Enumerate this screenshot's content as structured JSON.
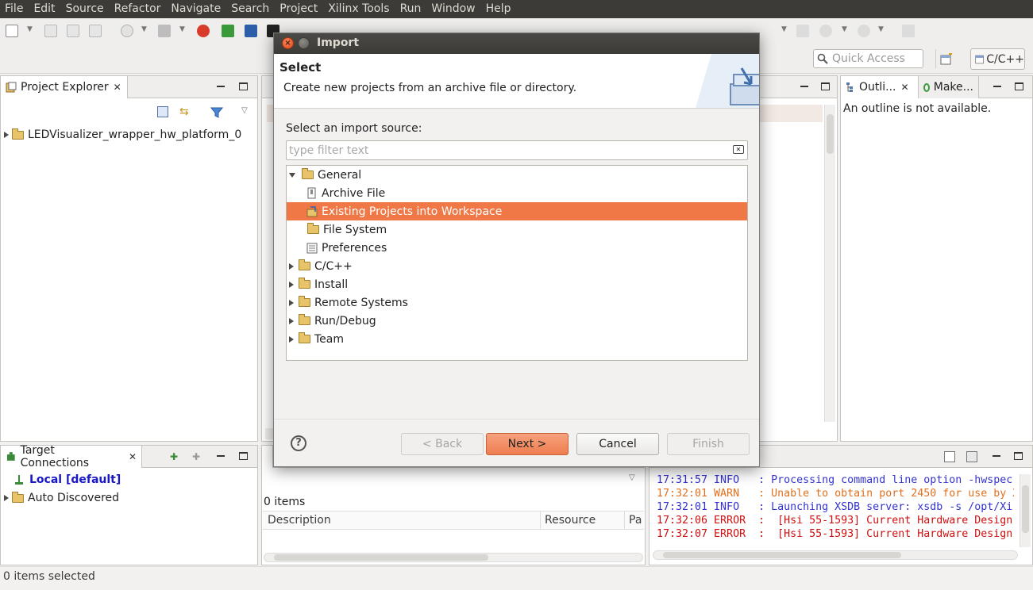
{
  "menubar": {
    "items": [
      "File",
      "Edit",
      "Source",
      "Refactor",
      "Navigate",
      "Search",
      "Project",
      "Xilinx Tools",
      "Run",
      "Window",
      "Help"
    ]
  },
  "toolbar": {
    "quick_access_placeholder": "Quick Access",
    "perspective_label": "C/C++"
  },
  "project_explorer": {
    "tab_label": "Project Explorer",
    "items": [
      {
        "label": "LEDVisualizer_wrapper_hw_platform_0"
      }
    ]
  },
  "outline": {
    "tab_label": "Outli...",
    "tab2_label": "Make...",
    "message": "An outline is not available."
  },
  "target_connections": {
    "tab_label": "Target Connections",
    "items": [
      "Local [default]",
      "Auto Discovered"
    ]
  },
  "problems": {
    "count_label": "0 items",
    "columns": [
      "Description",
      "Resource",
      "Pa"
    ]
  },
  "console": {
    "lines": [
      {
        "time": "17:31:57",
        "level": "INFO",
        "text": "17:31:57 INFO   : Processing command line option -hwspec",
        "color": "#3333cc"
      },
      {
        "time": "17:32:01",
        "level": "WARN",
        "text": "17:32:01 WARN   : Unable to obtain port 2450 for use by X",
        "color": "#e0701e"
      },
      {
        "time": "17:32:01",
        "level": "INFO",
        "text": "17:32:01 INFO   : Launching XSDB server: xsdb -s /opt/Xi",
        "color": "#3333cc"
      },
      {
        "time": "17:32:06",
        "level": "ERROR",
        "text": "17:32:06 ERROR  :  [Hsi 55-1593] Current Hardware Design",
        "color": "#cc1111"
      },
      {
        "time": "17:32:07",
        "level": "ERROR",
        "text": "17:32:07 ERROR  :  [Hsi 55-1593] Current Hardware Design",
        "color": "#cc1111"
      }
    ]
  },
  "status_bar": {
    "text": "0 items selected"
  },
  "dialog": {
    "title": "Import",
    "header_title": "Select",
    "header_desc": "Create new projects from an archive file or directory.",
    "source_label": "Select an import source:",
    "filter_placeholder": "type filter text",
    "tree": [
      {
        "label": "General",
        "level": 0,
        "expanded": true,
        "type": "folder"
      },
      {
        "label": "Archive File",
        "level": 1,
        "type": "archive"
      },
      {
        "label": "Existing Projects into Workspace",
        "level": 1,
        "type": "project",
        "selected": true
      },
      {
        "label": "File System",
        "level": 1,
        "type": "folder"
      },
      {
        "label": "Preferences",
        "level": 1,
        "type": "prefs"
      },
      {
        "label": "C/C++",
        "level": 0,
        "expanded": false,
        "type": "folder"
      },
      {
        "label": "Install",
        "level": 0,
        "expanded": false,
        "type": "folder"
      },
      {
        "label": "Remote Systems",
        "level": 0,
        "expanded": false,
        "type": "folder"
      },
      {
        "label": "Run/Debug",
        "level": 0,
        "expanded": false,
        "type": "folder"
      },
      {
        "label": "Team",
        "level": 0,
        "expanded": false,
        "type": "folder"
      }
    ],
    "buttons": {
      "back": "< Back",
      "next": "Next >",
      "cancel": "Cancel",
      "finish": "Finish"
    },
    "help_glyph": "?"
  },
  "colors": {
    "selection": "#f07746",
    "menubar_bg": "#3c3b37"
  }
}
